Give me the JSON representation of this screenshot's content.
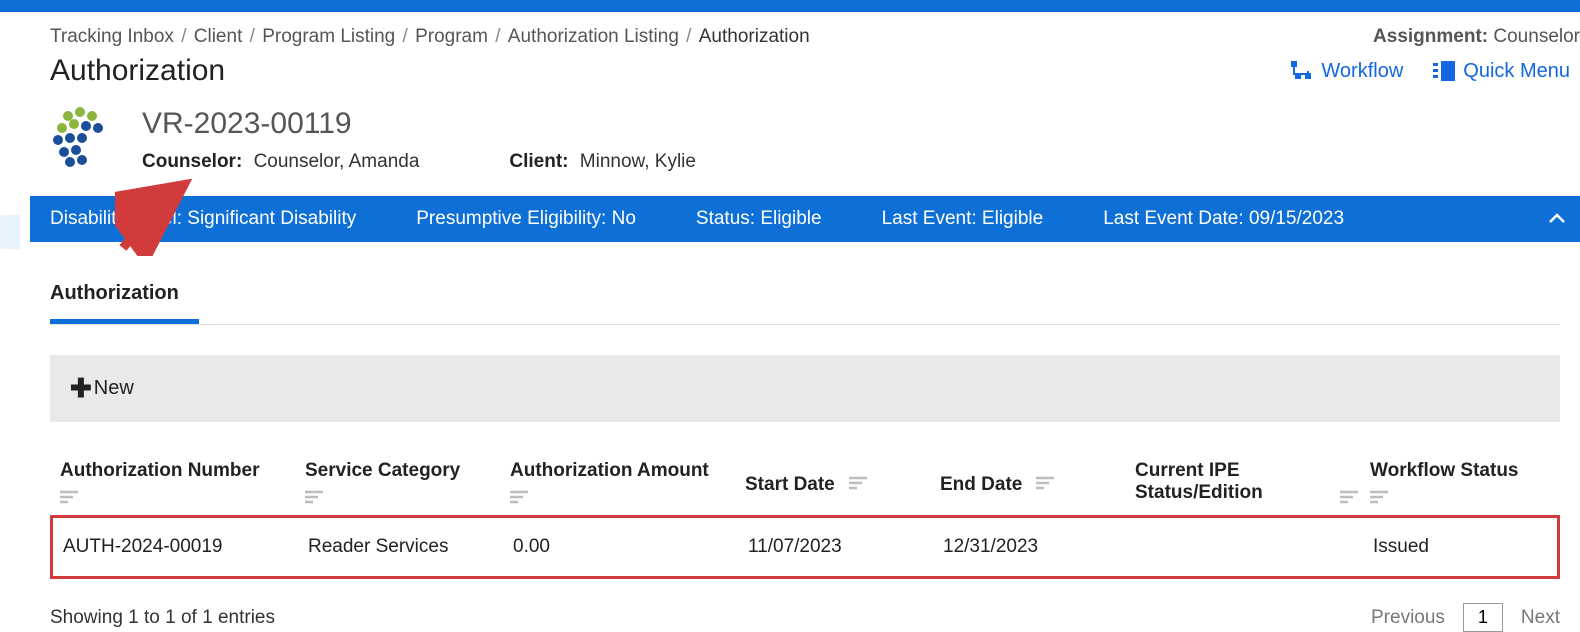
{
  "breadcrumb": [
    "Tracking Inbox",
    "Client",
    "Program Listing",
    "Program",
    "Authorization Listing",
    "Authorization"
  ],
  "assignment": {
    "label": "Assignment:",
    "value": "Counselor"
  },
  "page_title": "Authorization",
  "header_links": {
    "workflow": "Workflow",
    "quick_menu": "Quick Menu"
  },
  "record": {
    "id": "VR-2023-00119",
    "counselor_label": "Counselor:",
    "counselor_value": "Counselor, Amanda",
    "client_label": "Client:",
    "client_value": "Minnow, Kylie"
  },
  "info_band": [
    {
      "label": "Disability Level:",
      "value": "Significant Disability"
    },
    {
      "label": "Presumptive Eligibility:",
      "value": "No"
    },
    {
      "label": "Status:",
      "value": "Eligible"
    },
    {
      "label": "Last Event:",
      "value": "Eligible"
    },
    {
      "label": "Last Event Date:",
      "value": "09/15/2023"
    }
  ],
  "tabs": [
    {
      "label": "Authorization",
      "active": true
    }
  ],
  "toolbar": {
    "new": "New"
  },
  "columns": [
    "Authorization Number",
    "Service Category",
    "Authorization Amount",
    "Start Date",
    "End Date",
    "Current IPE Status/Edition",
    "Workflow Status"
  ],
  "rows": [
    {
      "auth_number": "AUTH-2024-00019",
      "service_category": "Reader Services",
      "amount": "0.00",
      "start_date": "11/07/2023",
      "end_date": "12/31/2023",
      "ipe_status": "",
      "workflow_status": "Issued"
    }
  ],
  "footer": {
    "showing": "Showing 1 to 1 of 1 entries",
    "previous": "Previous",
    "page": "1",
    "next": "Next"
  }
}
